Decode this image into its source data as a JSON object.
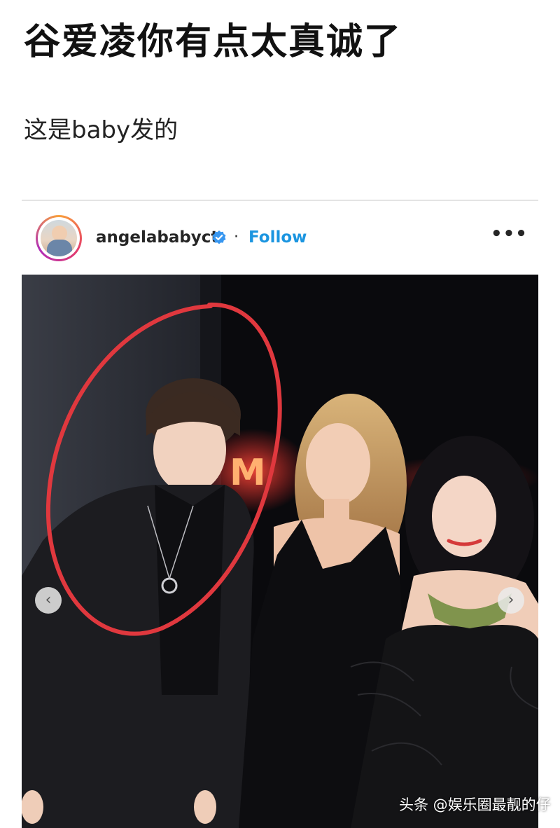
{
  "article": {
    "headline": "谷爱凌你有点太真诚了",
    "subline": "这是baby发的"
  },
  "post": {
    "username": "angelababyct",
    "separator": "·",
    "follow_label": "Follow",
    "more_label": "•••",
    "prev_label": "‹",
    "next_label": "›"
  },
  "colors": {
    "follow": "#1b95e0",
    "highlight_circle": "#e0383e",
    "verified_badge": "#3897f0"
  },
  "icons": [
    "verified-badge-icon",
    "more-options-icon",
    "chevron-left-icon",
    "chevron-right-icon"
  ],
  "watermark": {
    "text": "头条 @娱乐圈最靓的仔"
  }
}
